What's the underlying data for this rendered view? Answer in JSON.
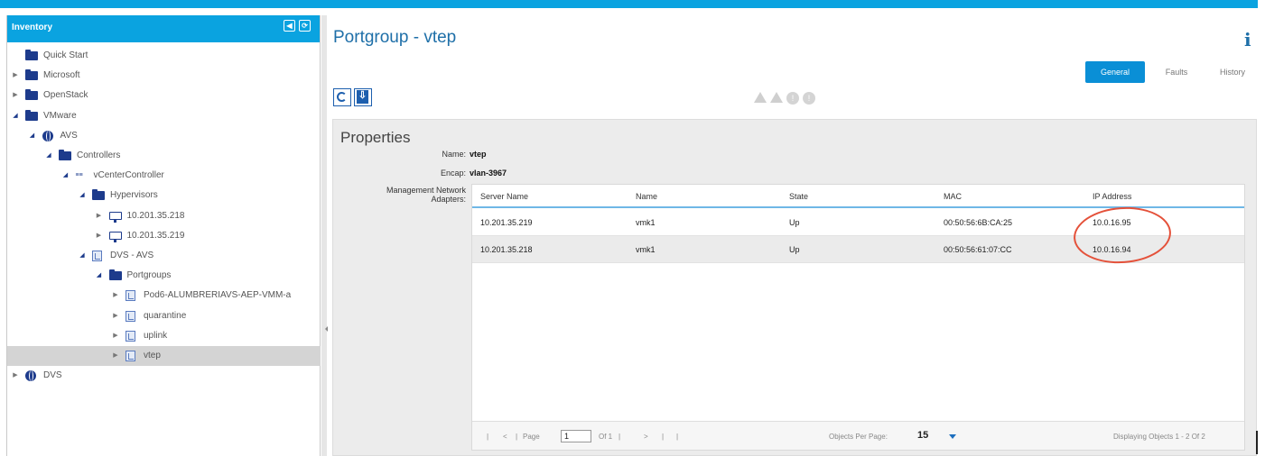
{
  "inventory": {
    "title": "Inventory",
    "tree": [
      {
        "label": "Quick Start",
        "icon": "folder-icon",
        "level": 0,
        "arrow": ""
      },
      {
        "label": "Microsoft",
        "icon": "folder-icon",
        "level": 0,
        "arrow": "collapsed"
      },
      {
        "label": "OpenStack",
        "icon": "folder-icon",
        "level": 0,
        "arrow": "collapsed"
      },
      {
        "label": "VMware",
        "icon": "folder-icon",
        "level": 0,
        "arrow": "expanded"
      },
      {
        "label": "AVS",
        "icon": "globe-icon",
        "level": 1,
        "arrow": "expanded"
      },
      {
        "label": "Controllers",
        "icon": "folder-icon",
        "level": 2,
        "arrow": "expanded"
      },
      {
        "label": "vCenterController",
        "icon": "vcenter-icon",
        "level": 3,
        "arrow": "expanded"
      },
      {
        "label": "Hypervisors",
        "icon": "folder-icon",
        "level": 4,
        "arrow": "expanded"
      },
      {
        "label": "10.201.35.218",
        "icon": "monitor-icon",
        "level": 5,
        "arrow": "collapsed"
      },
      {
        "label": "10.201.35.219",
        "icon": "monitor-icon",
        "level": 5,
        "arrow": "collapsed"
      },
      {
        "label": "DVS - AVS",
        "icon": "dvs-icon",
        "level": 4,
        "arrow": "expanded"
      },
      {
        "label": "Portgroups",
        "icon": "folder-icon",
        "level": 5,
        "arrow": "expanded"
      },
      {
        "label": "Pod6-ALUMBRERIAVS-AEP-VMM-a",
        "icon": "portgroup-icon",
        "level": 6,
        "arrow": "collapsed"
      },
      {
        "label": "quarantine",
        "icon": "portgroup-icon",
        "level": 6,
        "arrow": "collapsed"
      },
      {
        "label": "uplink",
        "icon": "portgroup-icon",
        "level": 6,
        "arrow": "collapsed"
      },
      {
        "label": "vtep",
        "icon": "portgroup-icon",
        "level": 6,
        "arrow": "collapsed",
        "selected": true
      },
      {
        "label": "DVS",
        "icon": "globe-icon",
        "level": 0,
        "arrow": "collapsed"
      }
    ]
  },
  "page": {
    "title": "Portgroup - vtep",
    "tabs": [
      {
        "label": "General",
        "active": true
      },
      {
        "label": "Faults",
        "active": false
      },
      {
        "label": "History",
        "active": false
      }
    ]
  },
  "properties": {
    "title": "Properties",
    "name_label": "Name:",
    "name_value": "vtep",
    "encap_label": "Encap:",
    "encap_value": "vlan-3967",
    "adapters_label_line1": "Management Network",
    "adapters_label_line2": "Adapters:"
  },
  "adapters_table": {
    "columns": [
      "Server Name",
      "Name",
      "State",
      "MAC",
      "IP Address"
    ],
    "rows": [
      [
        "10.201.35.219",
        "vmk1",
        "Up",
        "00:50:56:6B:CA:25",
        "10.0.16.95"
      ],
      [
        "10.201.35.218",
        "vmk1",
        "Up",
        "00:50:56:61:07:CC",
        "10.0.16.94"
      ]
    ]
  },
  "pager": {
    "page_label": "Page",
    "page_value": "1",
    "of_label": "Of 1",
    "per_page_label": "Objects Per Page:",
    "per_page_value": "15",
    "displaying": "Displaying Objects 1 - 2 Of 2"
  },
  "colors": {
    "accent": "#0aa3e0",
    "title_blue": "#1e6fa8",
    "annotation_red": "#e4513a"
  }
}
